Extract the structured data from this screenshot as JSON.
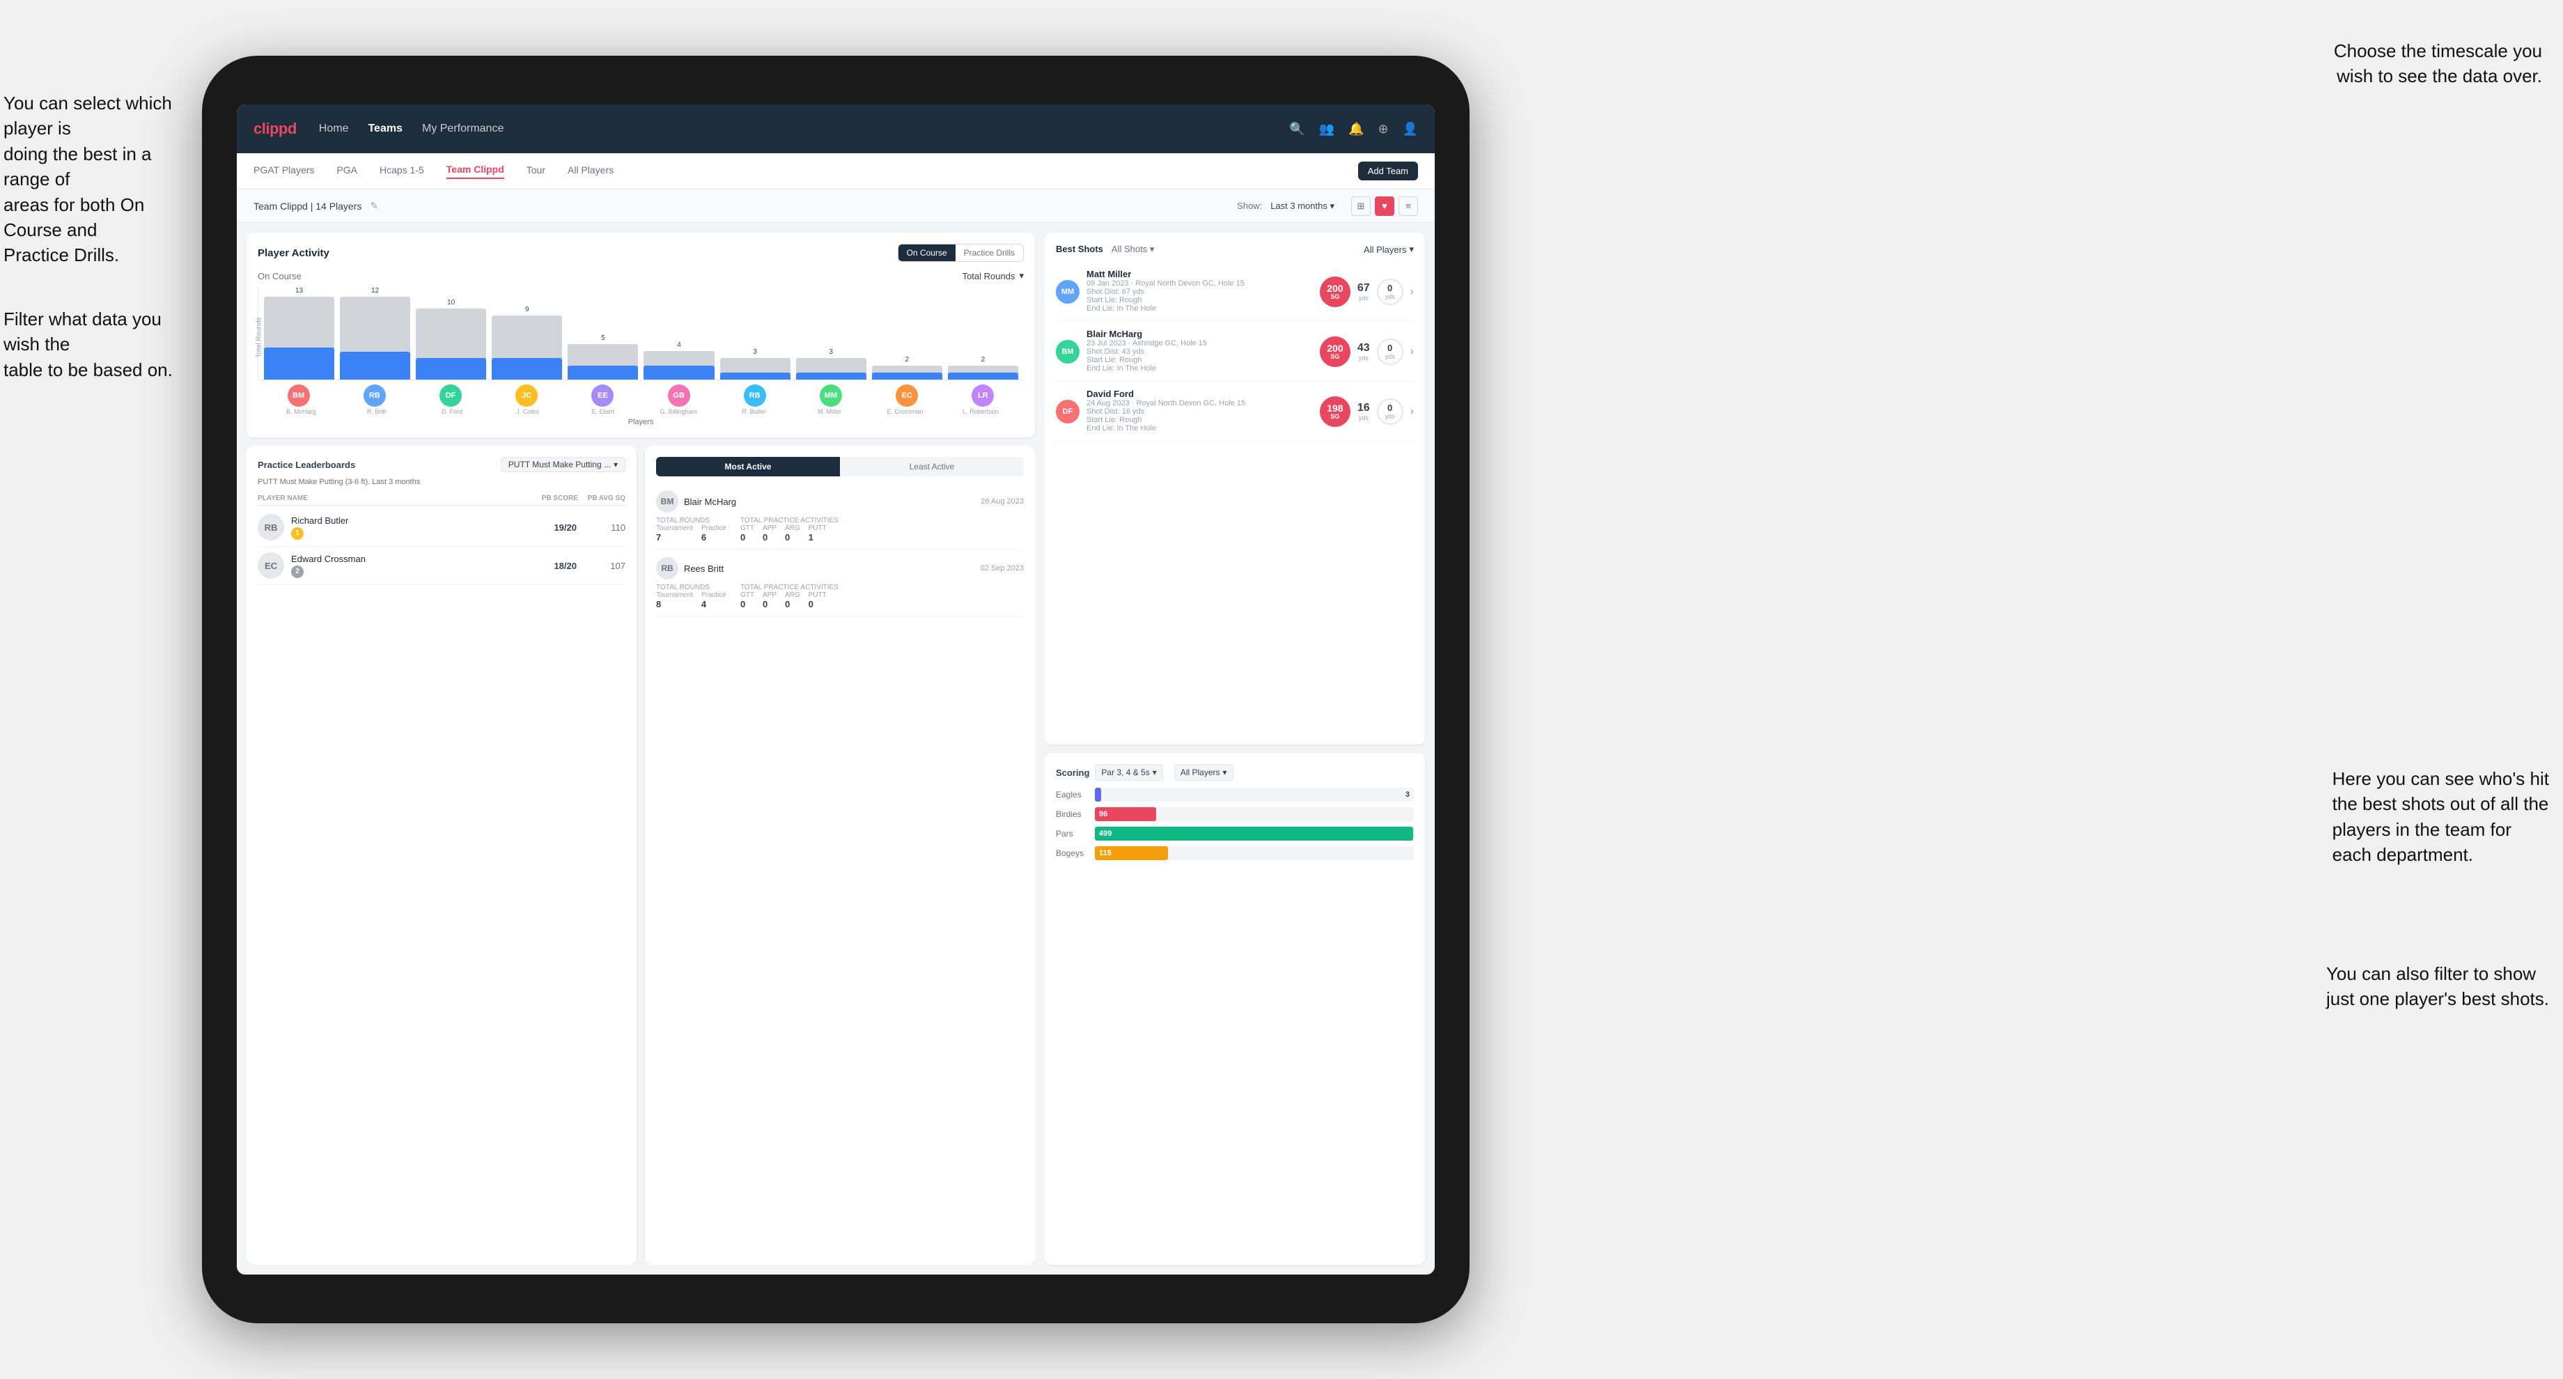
{
  "annotations": {
    "ann1_line1": "You can select which player is",
    "ann1_line2": "doing the best in a range of",
    "ann1_line3": "areas for both On Course and",
    "ann1_line4": "Practice Drills.",
    "ann2_line1": "Choose the timescale you",
    "ann2_line2": "wish to see the data over.",
    "ann3_line1": "Filter what data you wish the",
    "ann3_line2": "table to be based on.",
    "ann4_line1": "Here you can see who's hit",
    "ann4_line2": "the best shots out of all the",
    "ann4_line3": "players in the team for",
    "ann4_line4": "each department.",
    "ann5_line1": "You can also filter to show",
    "ann5_line2": "just one player's best shots."
  },
  "navbar": {
    "logo": "clippd",
    "items": [
      "Home",
      "Teams",
      "My Performance"
    ],
    "active": "Teams"
  },
  "tabs": {
    "items": [
      "PGAT Players",
      "PGA",
      "Hcaps 1-5",
      "Team Clippd",
      "Tour",
      "All Players"
    ],
    "active": "Team Clippd",
    "add_button": "Add Team"
  },
  "team_header": {
    "name": "Team Clippd | 14 Players",
    "show_label": "Show:",
    "show_value": "Last 3 months",
    "chevron": "▾"
  },
  "player_activity": {
    "title": "Player Activity",
    "toggle_oncourse": "On Course",
    "toggle_practice": "Practice Drills",
    "section_label": "On Course",
    "dropdown_label": "Total Rounds",
    "y_axis_label": "Total Rounds",
    "bars": [
      {
        "value": 13,
        "name": "B. McHarg",
        "highlight": 5
      },
      {
        "value": 12,
        "name": "R. Britt",
        "highlight": 4
      },
      {
        "value": 10,
        "name": "D. Ford",
        "highlight": 3
      },
      {
        "value": 9,
        "name": "J. Coles",
        "highlight": 3
      },
      {
        "value": 5,
        "name": "E. Ebert",
        "highlight": 2
      },
      {
        "value": 4,
        "name": "G. Billingham",
        "highlight": 2
      },
      {
        "value": 3,
        "name": "R. Butler",
        "highlight": 1
      },
      {
        "value": 3,
        "name": "M. Miller",
        "highlight": 1
      },
      {
        "value": 2,
        "name": "E. Crossman",
        "highlight": 1
      },
      {
        "value": 2,
        "name": "L. Robertson",
        "highlight": 1
      }
    ],
    "x_label": "Players"
  },
  "practice_leaderboards": {
    "title": "Practice Leaderboards",
    "drill_label": "PUTT Must Make Putting ...",
    "subtitle": "PUTT Must Make Putting (3-6 ft). Last 3 months",
    "col_player": "PLAYER NAME",
    "col_pb": "PB SCORE",
    "col_avg": "PB AVG SQ",
    "players": [
      {
        "name": "Richard Butler",
        "rank": "1",
        "rank_type": "gold",
        "score": "19/20",
        "avg": "110"
      },
      {
        "name": "Edward Crossman",
        "rank": "2",
        "rank_type": "silver",
        "score": "18/20",
        "avg": "107"
      }
    ]
  },
  "most_active": {
    "tab_most": "Most Active",
    "tab_least": "Least Active",
    "players": [
      {
        "name": "Blair McHarg",
        "date": "26 Aug 2023",
        "total_rounds_label": "Total Rounds",
        "tournament": "7",
        "practice": "6",
        "total_practice_label": "Total Practice Activities",
        "gtt": "0",
        "app": "0",
        "arg": "0",
        "putt": "1"
      },
      {
        "name": "Rees Britt",
        "date": "02 Sep 2023",
        "total_rounds_label": "Total Rounds",
        "tournament": "8",
        "practice": "4",
        "total_practice_label": "Total Practice Activities",
        "gtt": "0",
        "app": "0",
        "arg": "0",
        "putt": "0"
      }
    ]
  },
  "best_shots": {
    "title_best": "Best Shots",
    "title_all": "All Shots",
    "all_players": "All Players",
    "chevron": "▾",
    "shots": [
      {
        "player": "Matt Miller",
        "detail": "09 Jan 2023 · Royal North Devon GC, Hole 15",
        "sg_value": "200",
        "sg_label": "SG",
        "desc": "Shot Dist: 67 yds\nStart Lie: Rough\nEnd Lie: In The Hole",
        "dist_val": "67",
        "dist_unit": "yds",
        "zero_val": "0",
        "zero_unit": "yds"
      },
      {
        "player": "Blair McHarg",
        "detail": "23 Jul 2023 · Ashridge GC, Hole 15",
        "sg_value": "200",
        "sg_label": "SG",
        "desc": "Shot Dist: 43 yds\nStart Lie: Rough\nEnd Lie: In The Hole",
        "dist_val": "43",
        "dist_unit": "yds",
        "zero_val": "0",
        "zero_unit": "yds"
      },
      {
        "player": "David Ford",
        "detail": "24 Aug 2023 · Royal North Devon GC, Hole 15",
        "sg_value": "198",
        "sg_label": "SG",
        "desc": "Shot Dist: 16 yds\nStart Lie: Rough\nEnd Lie: In The Hole",
        "dist_val": "16",
        "dist_unit": "yds",
        "zero_val": "0",
        "zero_unit": "yds"
      }
    ]
  },
  "scoring": {
    "title": "Scoring",
    "dropdown1": "Par 3, 4 & 5s",
    "dropdown2": "All Players",
    "rows": [
      {
        "label": "Eagles",
        "value": 3,
        "max": 500,
        "color": "#6366f1"
      },
      {
        "label": "Birdies",
        "value": 96,
        "max": 500,
        "color": "#e8475f"
      },
      {
        "label": "Pars",
        "value": 499,
        "max": 500,
        "color": "#10b981"
      },
      {
        "label": "Bogeys",
        "value": 115,
        "max": 500,
        "color": "#f59e0b"
      }
    ]
  },
  "icons": {
    "search": "🔍",
    "user": "👤",
    "bell": "🔔",
    "circle_plus": "⊕",
    "avatar": "👤",
    "pencil": "✎",
    "chevron_down": "▾",
    "chevron_right": "›",
    "grid": "⊞",
    "heart": "♥",
    "bars": "≡"
  }
}
